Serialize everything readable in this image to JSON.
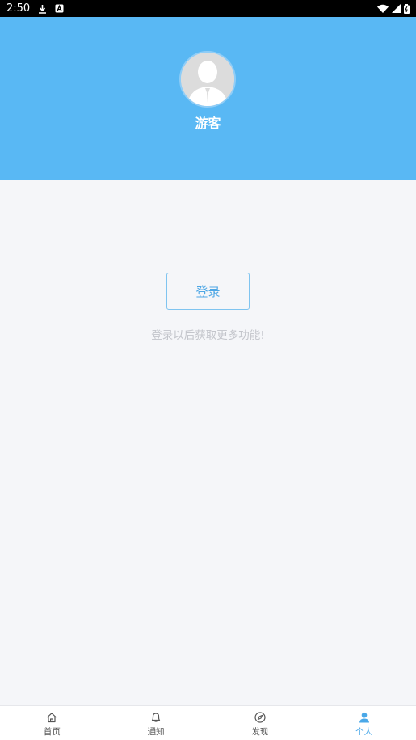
{
  "status_bar": {
    "time": "2:50"
  },
  "profile": {
    "username": "游客"
  },
  "main": {
    "login_label": "登录",
    "login_hint": "登录以后获取更多功能!"
  },
  "bottom_nav": {
    "items": [
      {
        "label": "首页",
        "icon": "home-icon"
      },
      {
        "label": "通知",
        "icon": "bell-icon"
      },
      {
        "label": "发现",
        "icon": "compass-icon"
      },
      {
        "label": "个人",
        "icon": "person-icon",
        "active": true
      }
    ]
  },
  "colors": {
    "header": "#59b8f4",
    "accent": "#4aa8e8",
    "background": "#f5f6f9"
  }
}
